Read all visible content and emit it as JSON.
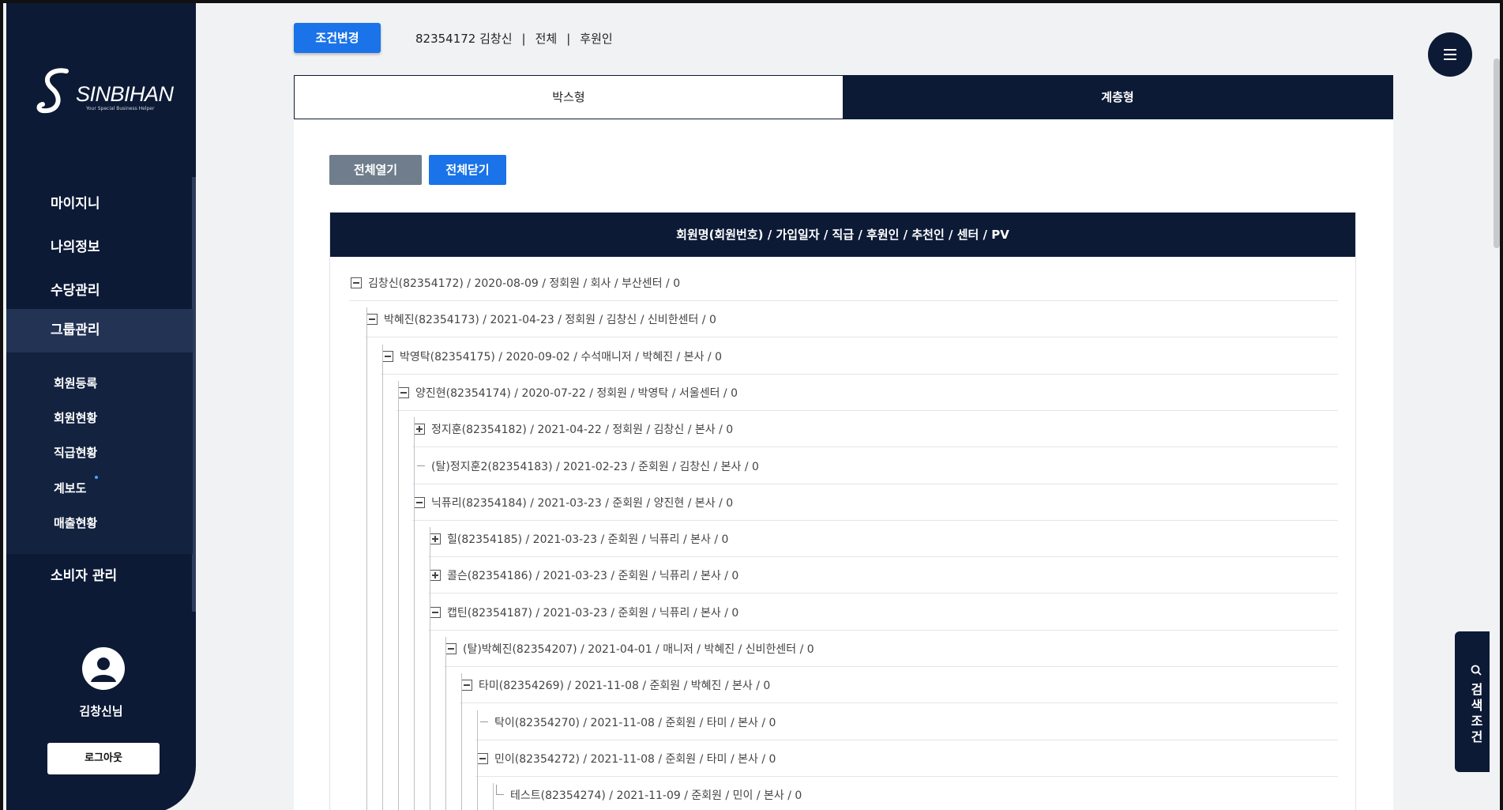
{
  "logo": {
    "text": "SINBIHAN",
    "tagline": "Your Special Business Helper"
  },
  "sidebar": {
    "main_items": [
      {
        "label": "마이지니"
      },
      {
        "label": "나의정보"
      },
      {
        "label": "수당관리"
      },
      {
        "label": "그룹관리"
      },
      {
        "label": "소비자 관리"
      }
    ],
    "active_item": "그룹관리",
    "sub_items": [
      {
        "label": "회원등록"
      },
      {
        "label": "회원현황"
      },
      {
        "label": "직급현황"
      },
      {
        "label": "계보도"
      },
      {
        "label": "매출현황"
      }
    ],
    "user_name": "김창신님",
    "logout_label": "로그아웃"
  },
  "header": {
    "condition_button": "조건변경",
    "member": "82354172 김창신",
    "scope": "전체",
    "relation": "후원인"
  },
  "tabs": [
    {
      "label": "박스형"
    },
    {
      "label": "계층형"
    }
  ],
  "active_tab": "계층형",
  "buttons": {
    "expand_all": "전체열기",
    "collapse_all": "전체닫기"
  },
  "tree_header": "회원명(회원번호) / 가입일자 / 직급 / 후원인 / 추천인 / 센터 / PV",
  "tree_rows": [
    {
      "text": "김창신(82354172) / 2020-08-09 / 정회원 / 회사 / 부산센터 / 0",
      "state": "expanded",
      "depth": 0
    },
    {
      "text": "박혜진(82354173) / 2021-04-23 / 정회원 / 김창신 / 신비한센터 / 0",
      "state": "expanded",
      "depth": 1
    },
    {
      "text": "박영탁(82354175) / 2020-09-02 / 수석매니저 / 박혜진 / 본사 / 0",
      "state": "expanded",
      "depth": 2
    },
    {
      "text": "양진현(82354174) / 2020-07-22 / 정회원 / 박영탁 / 서울센터 / 0",
      "state": "expanded",
      "depth": 3
    },
    {
      "text": "정지훈(82354182) / 2021-04-22 / 정회원 / 김창신 / 본사 / 0",
      "state": "collapsed",
      "depth": 4
    },
    {
      "text": "(탈)정지훈2(82354183) / 2021-02-23 / 준회원 / 김창신 / 본사 / 0",
      "state": "leaf",
      "depth": 4
    },
    {
      "text": "닉퓨리(82354184) / 2021-03-23 / 준회원 / 양진현 / 본사 / 0",
      "state": "expanded",
      "depth": 4
    },
    {
      "text": "힐(82354185) / 2021-03-23 / 준회원 / 닉퓨리 / 본사 / 0",
      "state": "collapsed",
      "depth": 5
    },
    {
      "text": "콜슨(82354186) / 2021-03-23 / 준회원 / 닉퓨리 / 본사 / 0",
      "state": "collapsed",
      "depth": 5
    },
    {
      "text": "캡틴(82354187) / 2021-03-23 / 준회원 / 닉퓨리 / 본사 / 0",
      "state": "expanded",
      "depth": 5
    },
    {
      "text": "(탈)박혜진(82354207) / 2021-04-01 / 매니저 / 박혜진 / 신비한센터 / 0",
      "state": "expanded",
      "depth": 6
    },
    {
      "text": "타미(82354269) / 2021-11-08 / 준회원 / 박혜진 / 본사 / 0",
      "state": "expanded",
      "depth": 7
    },
    {
      "text": "탁이(82354270) / 2021-11-08 / 준회원 / 타미 / 본사 / 0",
      "state": "leaf",
      "depth": 8
    },
    {
      "text": "민이(82354272) / 2021-11-08 / 준회원 / 타미 / 본사 / 0",
      "state": "expanded",
      "depth": 8
    },
    {
      "text": "테스트(82354274) / 2021-11-09 / 준회원 / 민이 / 본사 / 0",
      "state": "leaf-last",
      "depth": 9
    }
  ],
  "search_tab": {
    "label": "검색조건",
    "icon": "search-icon"
  },
  "colors": {
    "navy": "#0c1a36",
    "accent": "#1a73e8",
    "muted_button": "#6f7d8c"
  }
}
